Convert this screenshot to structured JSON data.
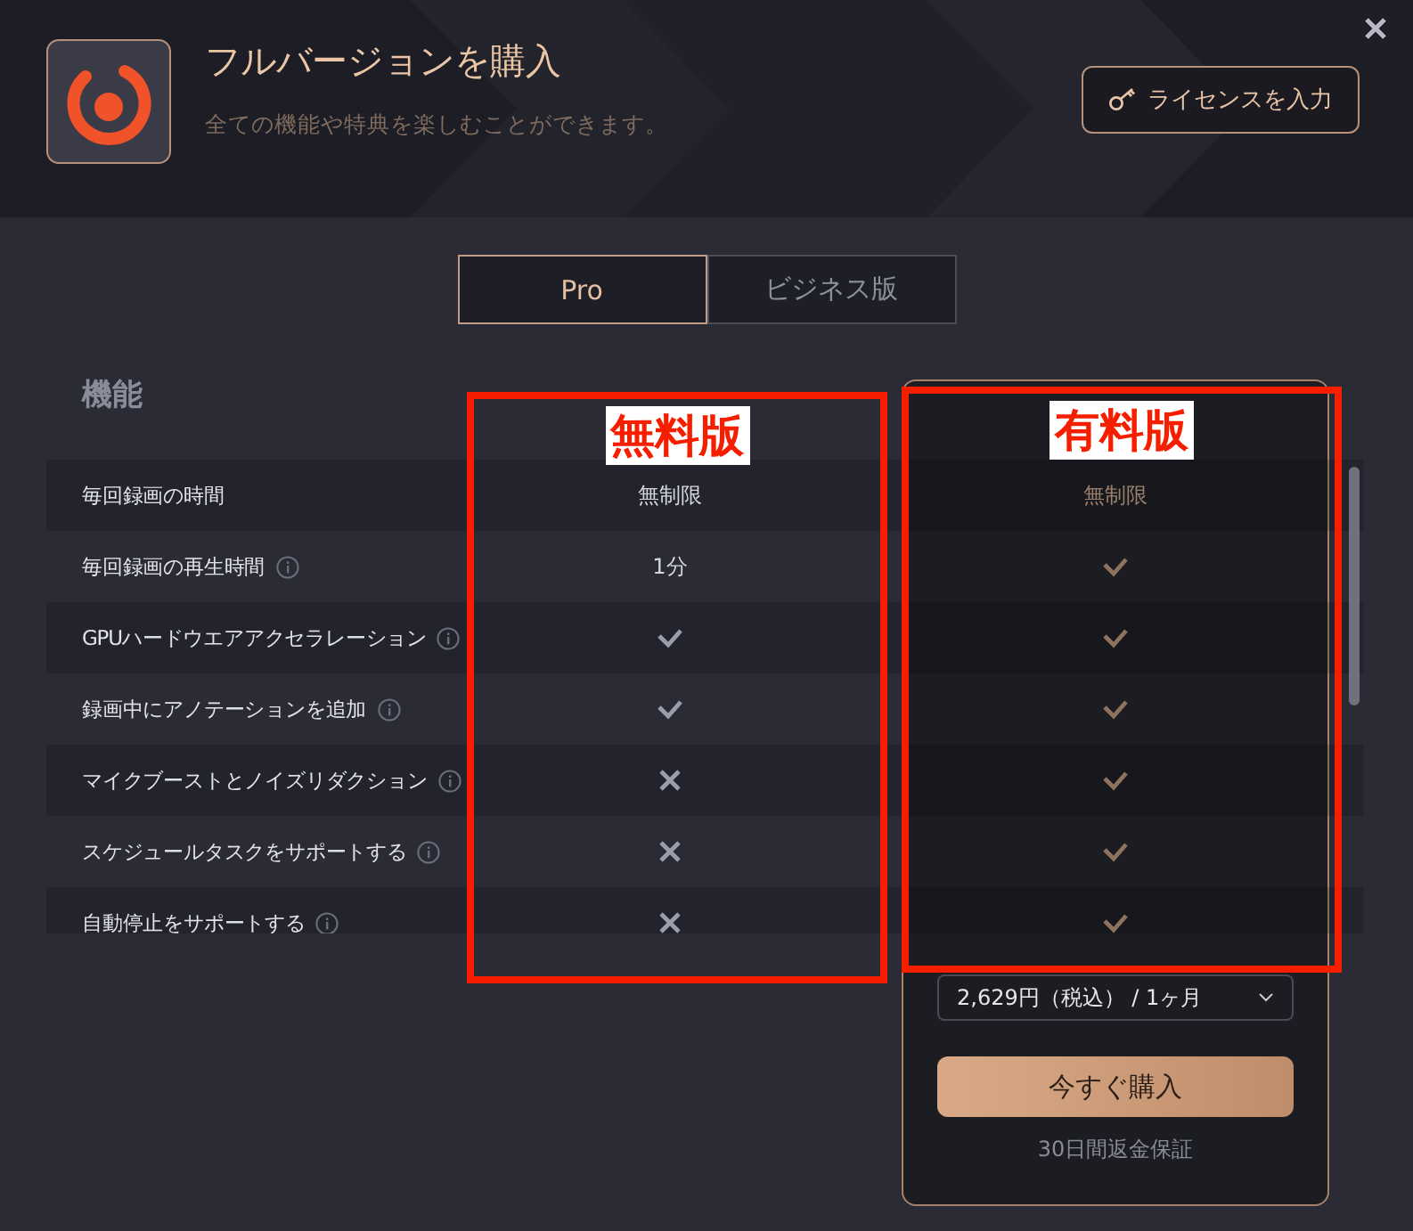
{
  "window": {
    "title": "フルバージョンを購入",
    "subtitle": "全ての機能や特典を楽しむことができます。",
    "license_button": "ライセンスを入力"
  },
  "tabs": [
    {
      "label": "Pro",
      "selected": true
    },
    {
      "label": "ビジネス版",
      "selected": false
    }
  ],
  "table": {
    "header": "機能",
    "rows": [
      {
        "feature": "毎回録画の時間",
        "info": false,
        "free": {
          "kind": "text",
          "text": "無制限"
        },
        "paid": {
          "kind": "text",
          "text": "無制限"
        }
      },
      {
        "feature": "毎回録画の再生時間",
        "info": true,
        "free": {
          "kind": "text",
          "text": "1分"
        },
        "paid": {
          "kind": "check"
        }
      },
      {
        "feature": "GPUハードウエアアクセラレーション",
        "info": true,
        "free": {
          "kind": "check"
        },
        "paid": {
          "kind": "check"
        }
      },
      {
        "feature": "録画中にアノテーションを追加",
        "info": true,
        "free": {
          "kind": "check"
        },
        "paid": {
          "kind": "check"
        }
      },
      {
        "feature": "マイクブーストとノイズリダクション",
        "info": true,
        "free": {
          "kind": "cross"
        },
        "paid": {
          "kind": "check"
        }
      },
      {
        "feature": "スケジュールタスクをサポートする",
        "info": true,
        "free": {
          "kind": "cross"
        },
        "paid": {
          "kind": "check"
        }
      },
      {
        "feature": "自動停止をサポートする",
        "info": true,
        "free": {
          "kind": "cross"
        },
        "paid": {
          "kind": "check"
        }
      }
    ]
  },
  "purchase": {
    "price": "2,629円（税込） / 1ヶ月",
    "button": "今すぐ購入",
    "guarantee": "30日間返金保証"
  },
  "annotations": [
    {
      "label": "無料版"
    },
    {
      "label": "有料版"
    }
  ]
}
